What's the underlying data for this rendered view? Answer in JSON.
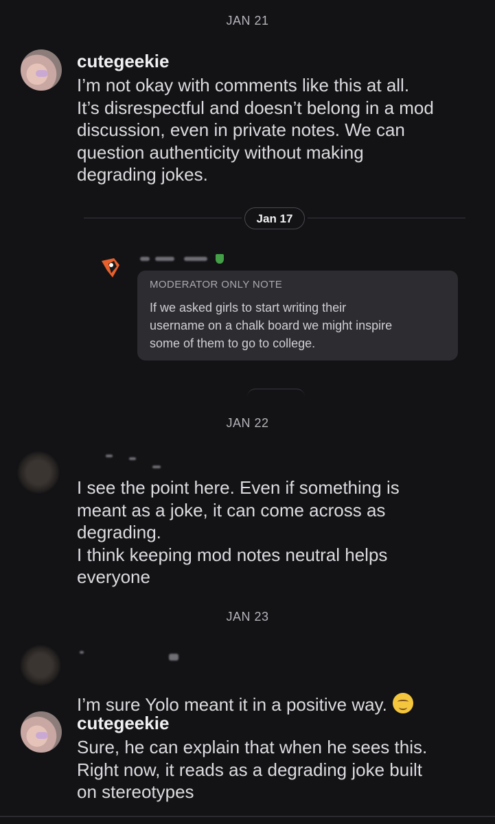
{
  "dates": {
    "jan21": "JAN 21",
    "jan17": "Jan 17",
    "jan22": "JAN 22",
    "jan23": "JAN 23"
  },
  "messages": [
    {
      "user": "cutegeekie",
      "text": "I’m not okay with comments like this at all.\nIt’s disrespectful and doesn’t belong in a mod\ndiscussion, even in private notes. We can\nquestion authenticity without making\ndegrading jokes."
    },
    {
      "user": "",
      "text": "I see the point here. Even if something is\nmeant as a joke, it can come across as\ndegrading.\nI think keeping mod notes neutral helps\neveryone"
    },
    {
      "user": "",
      "text": "I’m sure Yolo meant it in a positive way."
    },
    {
      "user": "cutegeekie",
      "text": "Sure, he can explain that when he sees this.\nRight now, it reads as a degrading joke built\non stereotypes"
    }
  ],
  "note": {
    "title": "MODERATOR ONLY NOTE",
    "body": "If we asked girls to start writing their\nusername on a chalk board we might inspire\nsome of them to go to college."
  },
  "icons": {
    "avatar_cutegeekie": "avatar-image",
    "mod_badge": "shield-icon",
    "emoji": "smiling-face-emoji"
  },
  "colors": {
    "background": "#131316",
    "card": "#2c2c31",
    "badge": "#43a047"
  }
}
